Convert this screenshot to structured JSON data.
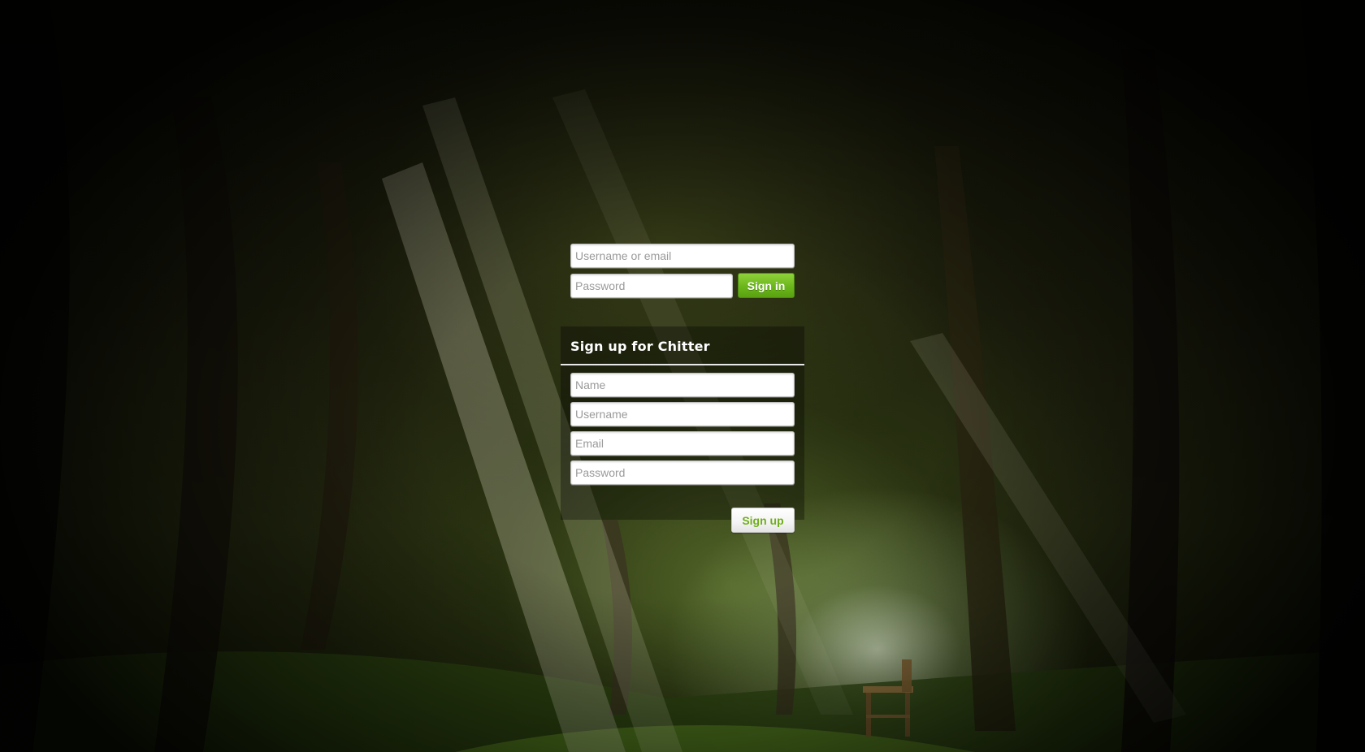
{
  "signin": {
    "username_placeholder": "Username or email",
    "password_placeholder": "Password",
    "button_label": "Sign in"
  },
  "signup": {
    "title": "Sign up for Chitter",
    "name_placeholder": "Name",
    "username_placeholder": "Username",
    "email_placeholder": "Email",
    "password_placeholder": "Password",
    "button_label": "Sign up"
  },
  "colors": {
    "accent_green": "#6bb61b",
    "signup_text_green": "#6fae1a",
    "panel_overlay": "rgba(0,0,0,0.32)"
  }
}
